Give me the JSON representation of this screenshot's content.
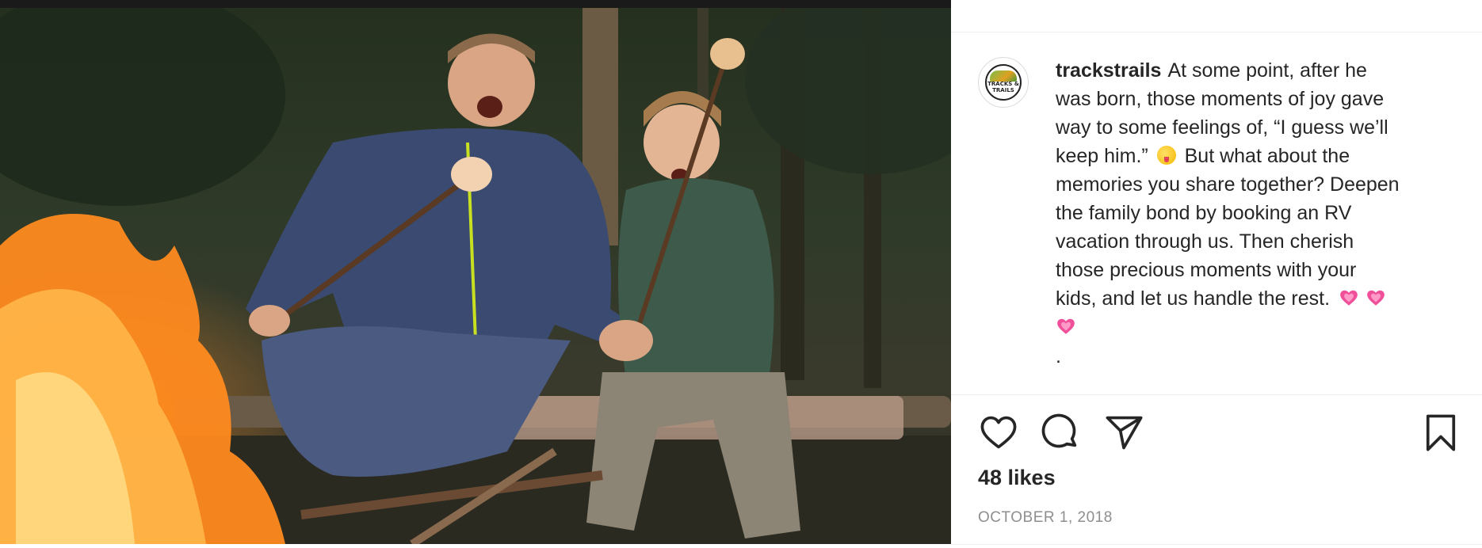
{
  "post": {
    "photo_alt": "father and son roasting marshmallows by a campfire",
    "username": "trackstrails",
    "avatar_icon": "tracks-trails-logo",
    "avatar_text": "TRACKS & TRAILS",
    "caption_lines": {
      "l1": "At some point, after he",
      "l2": "was born, those moments of joy gave",
      "l3": "way to some feelings of, “I guess we’ll",
      "l4a": "keep him.”",
      "l4b": "But what about the",
      "l5": "memories you share together? Deepen",
      "l6": "the family bond by booking an RV",
      "l7": "vacation through us. Then cherish",
      "l8": "those precious moments with your",
      "l9": "kids, and let us handle the rest."
    },
    "caption_trailing_dot": ".",
    "emojis": [
      "winking-face-tongue-emoji",
      "growing-heart-emoji",
      "growing-heart-emoji",
      "growing-heart-emoji"
    ],
    "likes": "48 likes",
    "date": "OCTOBER 1, 2018"
  },
  "actions": {
    "like_icon": "heart-icon",
    "comment_icon": "comment-icon",
    "share_icon": "paper-plane-icon",
    "save_icon": "bookmark-icon"
  },
  "colors": {
    "text": "#262626",
    "muted": "#8e8e8e",
    "divider": "#efefef",
    "heart_emoji": "#f0509a"
  }
}
